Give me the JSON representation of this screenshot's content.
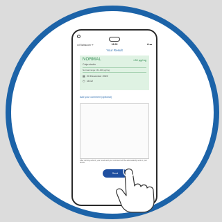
{
  "statusbar": {
    "carrier": "ıııl Swisscom ᯤ",
    "time": "16:08",
    "battery": "✱ ▬"
  },
  "screen": {
    "title": "Your Result"
  },
  "result": {
    "status": "NORMAL",
    "value": "<30 µg/mg",
    "test": "Calprotectin",
    "range": "Normal range: 30–100 µg/mg",
    "date": "20 December 2022",
    "time": "16:12"
  },
  "comment": {
    "label": "Add your comment (optional)",
    "value": ""
  },
  "note": "After clicking submit, your result and your comment will be automatically sent to your doctor.",
  "send_button": {
    "label": "Send"
  },
  "colors": {
    "ring": "#1c63a8",
    "accent": "#2f6fb0",
    "result_bg": "#dff2e3",
    "result_text": "#2e8a4e",
    "button": "#1f4fa0"
  },
  "icons": {
    "date": "calendar-icon",
    "time": "clock-icon"
  }
}
